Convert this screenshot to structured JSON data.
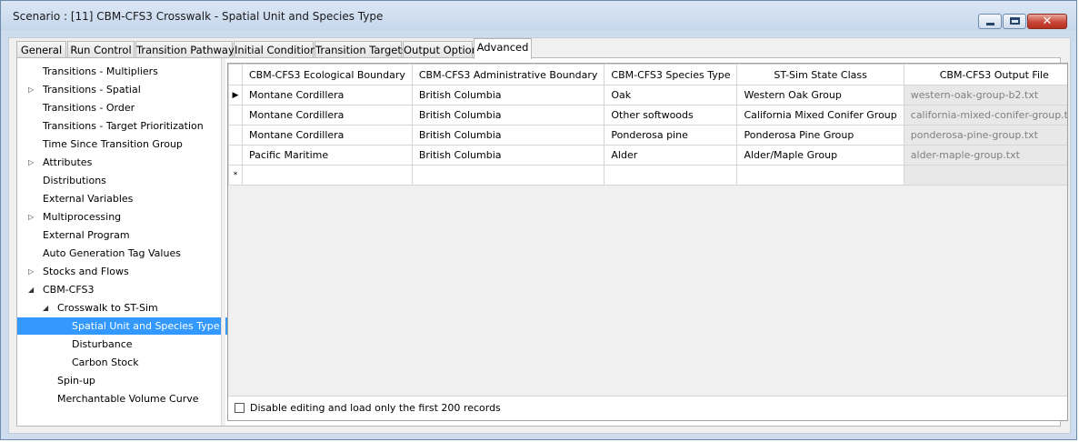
{
  "window": {
    "title": "Scenario : [11] CBM-CFS3 Crosswalk - Spatial Unit and Species Type",
    "controls": {
      "minimize_icon": "minimize-icon",
      "maximize_icon": "maximize-icon",
      "close_glyph": "✕"
    }
  },
  "tabs": [
    {
      "label": "General"
    },
    {
      "label": "Run Control"
    },
    {
      "label": "Transition Pathways"
    },
    {
      "label": "Initial Conditions"
    },
    {
      "label": "Transition Targets"
    },
    {
      "label": "Output Options"
    },
    {
      "label": "Advanced",
      "active": true
    }
  ],
  "tree": [
    {
      "label": "Transitions - Multipliers",
      "expander": ""
    },
    {
      "label": "Transitions - Spatial",
      "expander": "▷"
    },
    {
      "label": "Transitions - Order",
      "expander": ""
    },
    {
      "label": "Transitions - Target Prioritization",
      "expander": ""
    },
    {
      "label": "Time Since Transition Group",
      "expander": ""
    },
    {
      "label": "Attributes",
      "expander": "▷"
    },
    {
      "label": "Distributions",
      "expander": ""
    },
    {
      "label": "External Variables",
      "expander": ""
    },
    {
      "label": "Multiprocessing",
      "expander": "▷"
    },
    {
      "label": "External Program",
      "expander": ""
    },
    {
      "label": "Auto Generation Tag Values",
      "expander": ""
    },
    {
      "label": "Stocks and Flows",
      "expander": "▷"
    },
    {
      "label": "CBM-CFS3",
      "expander": "◢"
    },
    {
      "label": "Crosswalk to ST-Sim",
      "expander": "◢"
    },
    {
      "label": "Spatial Unit and Species Type",
      "expander": "",
      "selected": true
    },
    {
      "label": "Disturbance",
      "expander": ""
    },
    {
      "label": "Carbon Stock",
      "expander": ""
    },
    {
      "label": "Spin-up",
      "expander": ""
    },
    {
      "label": "Merchantable Volume Curve",
      "expander": ""
    }
  ],
  "grid": {
    "columns": [
      "CBM-CFS3 Ecological Boundary",
      "CBM-CFS3 Administrative Boundary",
      "CBM-CFS3 Species Type",
      "ST-Sim State Class",
      "CBM-CFS3 Output File"
    ],
    "rows": [
      {
        "indicator": "▶",
        "cells": [
          "Montane Cordillera",
          "British Columbia",
          "Oak",
          "Western Oak Group",
          "western-oak-group-b2.txt"
        ]
      },
      {
        "indicator": "",
        "cells": [
          "Montane Cordillera",
          "British Columbia",
          "Other softwoods",
          "California Mixed Conifer Group",
          "california-mixed-conifer-group.txt"
        ]
      },
      {
        "indicator": "",
        "cells": [
          "Montane Cordillera",
          "British Columbia",
          "Ponderosa pine",
          "Ponderosa Pine Group",
          "ponderosa-pine-group.txt"
        ]
      },
      {
        "indicator": "",
        "cells": [
          "Pacific Maritime",
          "British Columbia",
          "Alder",
          "Alder/Maple Group",
          "alder-maple-group.txt"
        ]
      }
    ],
    "new_row_indicator": "*",
    "delete_glyph": "✕",
    "open_icon": "folder-open-icon"
  },
  "footer": {
    "checkbox_label": "Disable editing and load only the first 200 records",
    "checked": false
  }
}
